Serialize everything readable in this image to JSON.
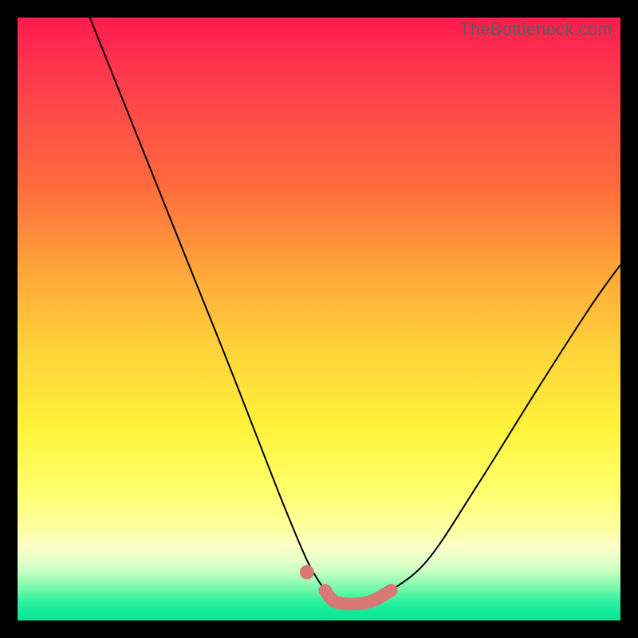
{
  "watermark": "TheBottleneck.com",
  "colors": {
    "frame": "#000000",
    "curve": "#000000",
    "series": "#d77a77",
    "gradient_top": "#ff1a4d",
    "gradient_bottom": "#0ce496"
  },
  "chart_data": {
    "type": "line",
    "title": "",
    "xlabel": "",
    "ylabel": "",
    "xlim": [
      0,
      100
    ],
    "ylim": [
      0,
      100
    ],
    "axes_visible": false,
    "grid": false,
    "background": "red-yellow-green vertical gradient (bottleneck heatmap)",
    "curves": [
      {
        "name": "left-limb",
        "description": "black curve descending from top-left into the valley floor",
        "points": [
          {
            "x": 12,
            "y": 100
          },
          {
            "x": 20,
            "y": 80
          },
          {
            "x": 28,
            "y": 60
          },
          {
            "x": 36,
            "y": 40
          },
          {
            "x": 43,
            "y": 22
          },
          {
            "x": 48,
            "y": 10
          },
          {
            "x": 51,
            "y": 5
          }
        ]
      },
      {
        "name": "right-limb",
        "description": "black curve rising from valley floor toward upper-right",
        "points": [
          {
            "x": 62,
            "y": 5
          },
          {
            "x": 68,
            "y": 10
          },
          {
            "x": 76,
            "y": 22
          },
          {
            "x": 86,
            "y": 38
          },
          {
            "x": 95,
            "y": 52
          },
          {
            "x": 100,
            "y": 59
          }
        ]
      }
    ],
    "series": [
      {
        "name": "highlighted-range",
        "description": "thick salmon segment along valley floor plus a detached dot on the left limb",
        "segment": [
          {
            "x": 51,
            "y": 5
          },
          {
            "x": 53,
            "y": 3
          },
          {
            "x": 58,
            "y": 3
          },
          {
            "x": 62,
            "y": 5
          }
        ],
        "detached_dot": {
          "x": 48,
          "y": 8
        }
      }
    ]
  }
}
